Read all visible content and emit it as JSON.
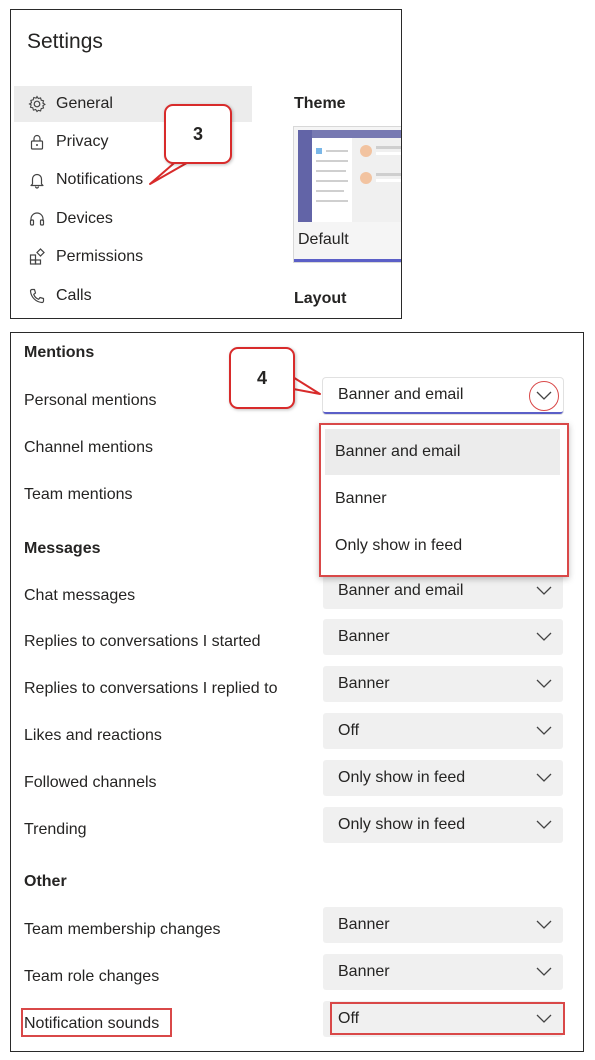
{
  "settings": {
    "title": "Settings",
    "nav": [
      {
        "label": "General",
        "icon": "gear-icon",
        "active": true
      },
      {
        "label": "Privacy",
        "icon": "lock-icon"
      },
      {
        "label": "Notifications",
        "icon": "bell-icon"
      },
      {
        "label": "Devices",
        "icon": "headset-icon"
      },
      {
        "label": "Permissions",
        "icon": "apps-icon"
      },
      {
        "label": "Calls",
        "icon": "phone-icon"
      }
    ],
    "theme_heading": "Theme",
    "theme_default_label": "Default",
    "layout_heading": "Layout",
    "callout_3": "3"
  },
  "notifications": {
    "callout_4": "4",
    "mentions": {
      "heading": "Mentions",
      "personal": {
        "label": "Personal mentions",
        "value": "Banner and email"
      },
      "channel": {
        "label": "Channel mentions"
      },
      "team": {
        "label": "Team mentions"
      }
    },
    "dropdown_options": [
      "Banner and email",
      "Banner",
      "Only show in feed"
    ],
    "messages": {
      "heading": "Messages",
      "rows": [
        {
          "label": "Chat messages",
          "value": "Banner and email"
        },
        {
          "label": "Replies to conversations I started",
          "value": "Banner"
        },
        {
          "label": "Replies to conversations I replied to",
          "value": "Banner"
        },
        {
          "label": "Likes and reactions",
          "value": "Off"
        },
        {
          "label": "Followed channels",
          "value": "Only show in feed"
        },
        {
          "label": "Trending",
          "value": "Only show in feed"
        }
      ]
    },
    "other": {
      "heading": "Other",
      "rows": [
        {
          "label": "Team membership changes",
          "value": "Banner"
        },
        {
          "label": "Team role changes",
          "value": "Banner"
        },
        {
          "label": "Notification sounds",
          "value": "Off"
        }
      ]
    }
  },
  "colors": {
    "accent": "#5b5fc7",
    "highlight": "#d94848"
  }
}
